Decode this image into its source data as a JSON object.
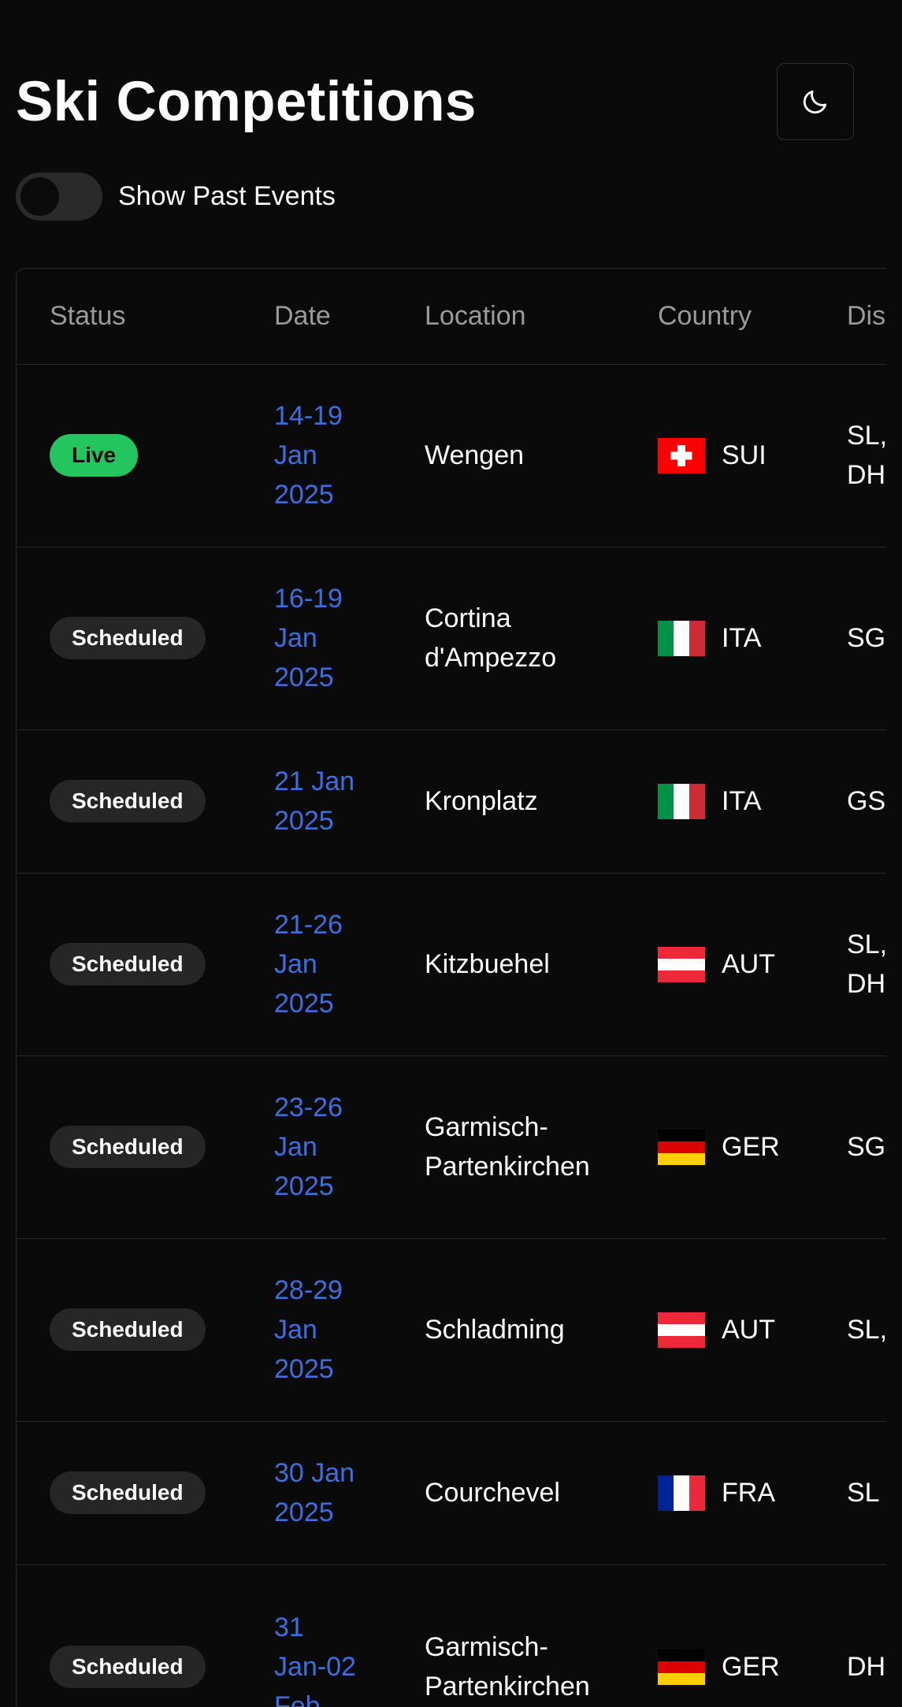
{
  "header": {
    "title": "Ski Competitions",
    "theme_icon": "moon-icon"
  },
  "filter": {
    "show_past_label": "Show Past Events",
    "show_past_enabled": false
  },
  "table": {
    "columns": [
      "Status",
      "Date",
      "Location",
      "Country",
      "Dis"
    ],
    "rows": [
      {
        "status": "Live",
        "date": [
          "14-19",
          "Jan",
          "2025"
        ],
        "location": [
          "Wengen"
        ],
        "flag": "SUI",
        "country": "SUI",
        "disciplines": [
          "SL,",
          "DH"
        ]
      },
      {
        "status": "Scheduled",
        "date": [
          "16-19",
          "Jan",
          "2025"
        ],
        "location": [
          "Cortina",
          "d'Ampezzo"
        ],
        "flag": "ITA",
        "country": "ITA",
        "disciplines": [
          "SG"
        ]
      },
      {
        "status": "Scheduled",
        "date": [
          "21 Jan",
          "2025"
        ],
        "location": [
          "Kronplatz"
        ],
        "flag": "ITA",
        "country": "ITA",
        "disciplines": [
          "GS"
        ]
      },
      {
        "status": "Scheduled",
        "date": [
          "21-26",
          "Jan",
          "2025"
        ],
        "location": [
          "Kitzbuehel"
        ],
        "flag": "AUT",
        "country": "AUT",
        "disciplines": [
          "SL,",
          "DH"
        ]
      },
      {
        "status": "Scheduled",
        "date": [
          "23-26",
          "Jan",
          "2025"
        ],
        "location": [
          "Garmisch-",
          "Partenkirchen"
        ],
        "flag": "GER",
        "country": "GER",
        "disciplines": [
          "SG"
        ]
      },
      {
        "status": "Scheduled",
        "date": [
          "28-29",
          "Jan",
          "2025"
        ],
        "location": [
          "Schladming"
        ],
        "flag": "AUT",
        "country": "AUT",
        "disciplines": [
          "SL,"
        ]
      },
      {
        "status": "Scheduled",
        "date": [
          "30 Jan",
          "2025"
        ],
        "location": [
          "Courchevel"
        ],
        "flag": "FRA",
        "country": "FRA",
        "disciplines": [
          "SL"
        ]
      },
      {
        "status": "Scheduled",
        "date": [
          "31",
          "Jan-02",
          "Feb"
        ],
        "location": [
          "Garmisch-",
          "Partenkirchen"
        ],
        "flag": "GER",
        "country": "GER",
        "disciplines": [
          "DH"
        ]
      }
    ]
  },
  "colors": {
    "background": "#0a0a0a",
    "accent_date": "#3b6fe0",
    "live_badge": "#22c55e",
    "scheduled_badge": "#262626",
    "header_text": "#9a9a9a",
    "border": "#2a2a2a"
  }
}
